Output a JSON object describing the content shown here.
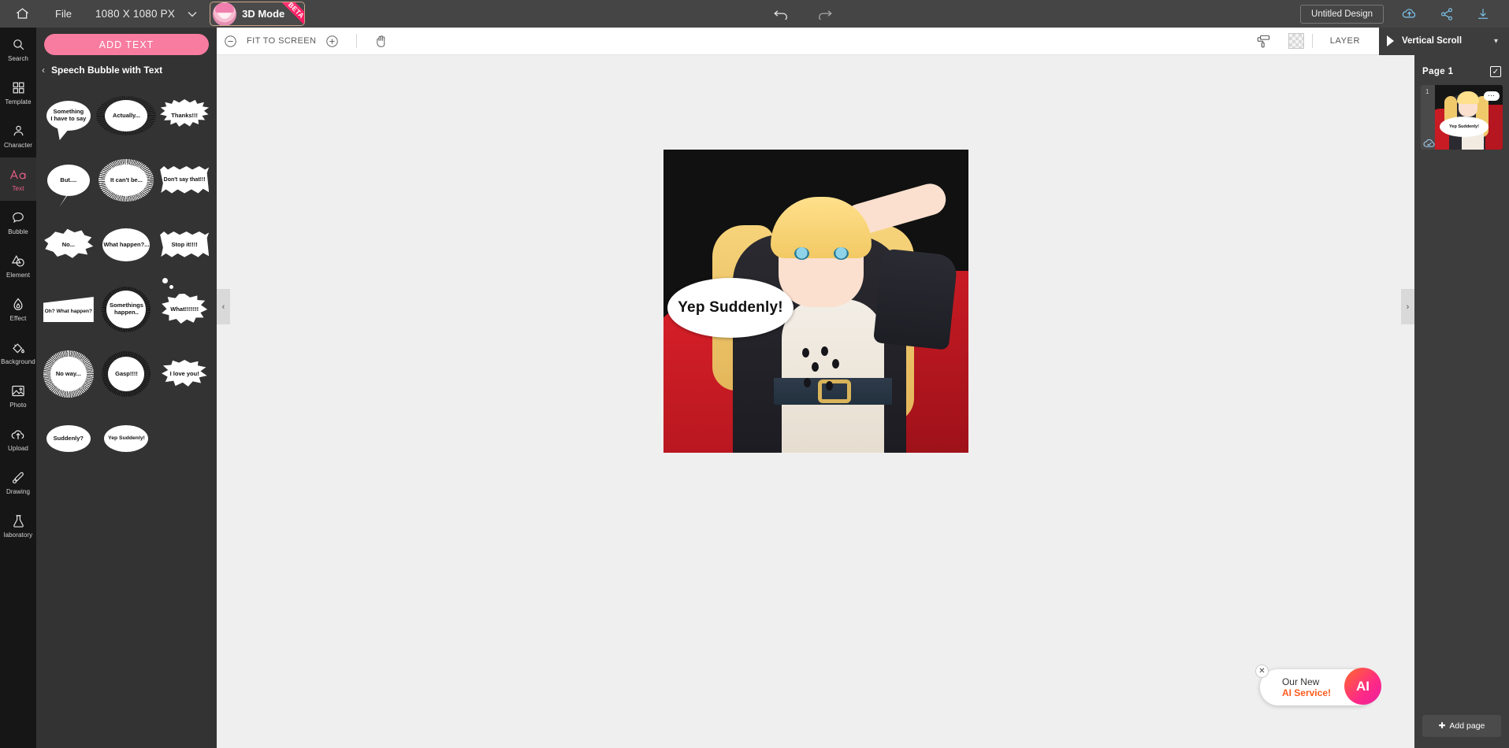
{
  "topbar": {
    "home_icon": "home-icon",
    "file_label": "File",
    "canvas_size": "1080 X 1080 PX",
    "size_caret": "chevron-down-icon",
    "mode_button_label": "3D Mode",
    "mode_badge": "BETA",
    "undo_icon": "undo-icon",
    "redo_icon": "redo-icon",
    "design_title": "Untitled Design",
    "cloud_icon": "cloud-upload-icon",
    "share_icon": "share-icon",
    "download_icon": "download-icon"
  },
  "rail": {
    "items": [
      {
        "label": "Search",
        "icon": "search-icon",
        "active": false
      },
      {
        "label": "Template",
        "icon": "grid-icon",
        "active": false
      },
      {
        "label": "Character",
        "icon": "person-icon",
        "active": false
      },
      {
        "label": "Text",
        "icon": "text-aa-icon",
        "active": true
      },
      {
        "label": "Bubble",
        "icon": "speech-bubble-icon",
        "active": false
      },
      {
        "label": "Element",
        "icon": "shapes-icon",
        "active": false
      },
      {
        "label": "Effect",
        "icon": "flame-icon",
        "active": false
      },
      {
        "label": "Background",
        "icon": "paint-bucket-icon",
        "active": false
      },
      {
        "label": "Photo",
        "icon": "image-icon",
        "active": false
      },
      {
        "label": "Upload",
        "icon": "upload-cloud-icon",
        "active": false
      },
      {
        "label": "Drawing",
        "icon": "pen-icon",
        "active": false
      },
      {
        "label": "laboratory",
        "icon": "flask-icon",
        "active": false
      }
    ]
  },
  "panel": {
    "add_text_label": "ADD TEXT",
    "back_icon": "chevron-left-icon",
    "title": "Speech Bubble with Text",
    "bubbles": [
      {
        "text": "Something\nI have to say",
        "shape": "oval-tail"
      },
      {
        "text": "Actually...",
        "shape": "fuzzy-dark-oval"
      },
      {
        "text": "Thanks!!!",
        "shape": "spiky-burst"
      },
      {
        "text": "But....",
        "shape": "round-tail"
      },
      {
        "text": "It can't be...",
        "shape": "radial-white-rays"
      },
      {
        "text": "Don't say that!!!",
        "shape": "jagged-rect"
      },
      {
        "text": "No...",
        "shape": "cloud-blob"
      },
      {
        "text": "What happen?...",
        "shape": "thought-bubble"
      },
      {
        "text": "Stop it!!!!",
        "shape": "flash-rect"
      },
      {
        "text": "Oh? What happen?",
        "shape": "trapezoid-tail"
      },
      {
        "text": "Somethings\nhappen..",
        "shape": "fuzzy-circle"
      },
      {
        "text": "What!!!!!!!",
        "shape": "star-burst"
      },
      {
        "text": "No way...",
        "shape": "radial-white-circle"
      },
      {
        "text": "Gasp!!!!",
        "shape": "fuzzy-dark-circle"
      },
      {
        "text": "I love you!",
        "shape": "star-burst-tail"
      },
      {
        "text": "Suddenly?",
        "shape": "plain-oval"
      },
      {
        "text": "Yep Suddenly!",
        "shape": "plain-oval"
      }
    ]
  },
  "subbar": {
    "zoom_out_icon": "minus-circle-icon",
    "zoom_label": "FIT TO SCREEN",
    "zoom_in_icon": "plus-circle-icon",
    "hand_icon": "hand-tool-icon",
    "roller_icon": "paint-roller-icon",
    "checker_icon": "transparency-swatch",
    "layer_label": "LAYER",
    "play_icon": "play-icon",
    "scroll_mode": "Vertical Scroll",
    "scroll_caret": "chevron-down-icon"
  },
  "canvas": {
    "left_arrow_icon": "chevron-left-icon",
    "right_arrow_icon": "chevron-right-icon",
    "bubble_text": "Yep Suddenly!"
  },
  "rightpanel": {
    "page_label": "Page 1",
    "check_icon": "check-icon",
    "thumb_number": "1",
    "thumb_menu_icon": "more-dots-icon",
    "thumb_bubble_text": "Yep Suddenly!",
    "thumb_cloud_icon": "cloud-check-icon",
    "add_page_label": "Add page",
    "add_page_icon": "plus-icon"
  },
  "ai_widget": {
    "close_icon": "close-icon",
    "line1": "Our New",
    "line2": "AI Service!",
    "badge": "AI"
  },
  "colors": {
    "accent_pink": "#f87ca0",
    "topbar_bg": "#454545",
    "rail_bg": "#161616",
    "panel_bg": "#333333",
    "canvas_bg": "#efefef",
    "ai_orange": "#ff5a1f"
  }
}
